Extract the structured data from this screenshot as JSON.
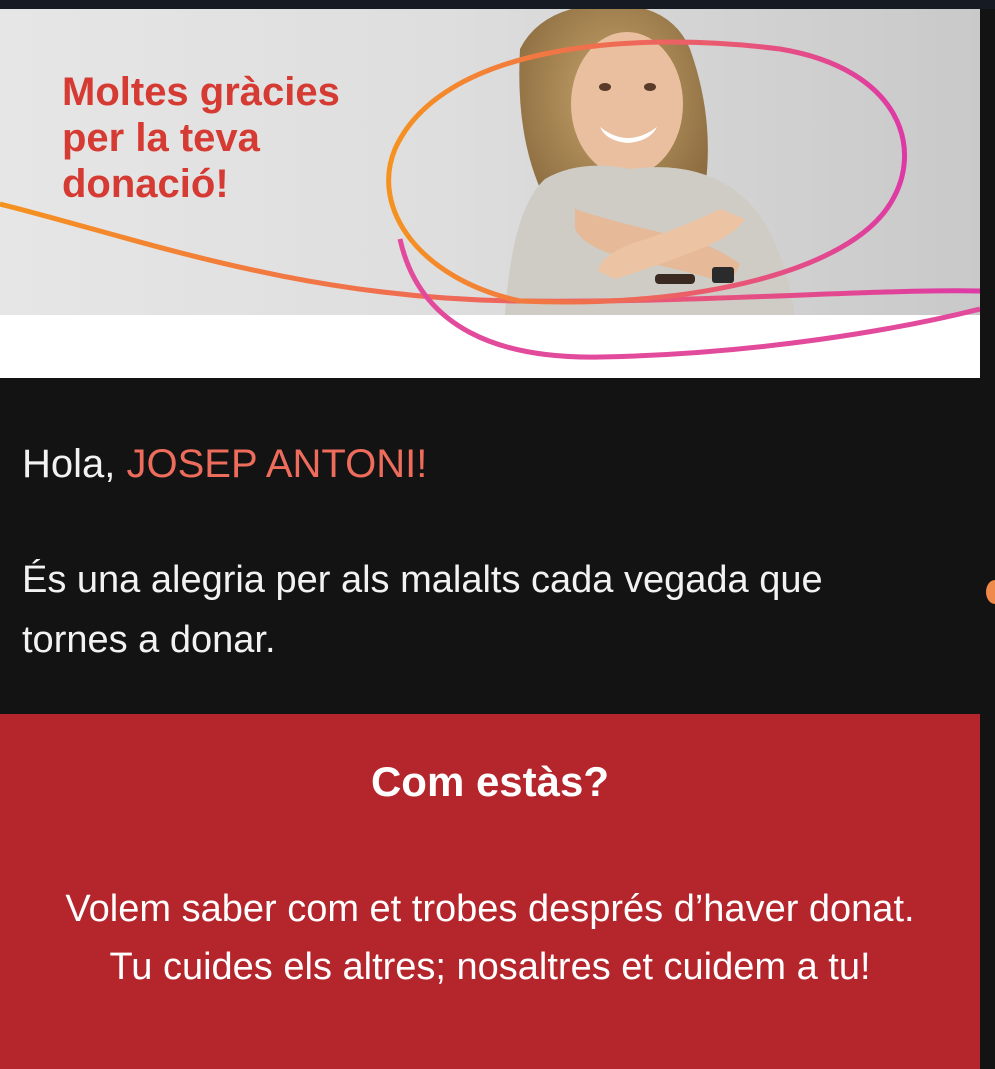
{
  "banner": {
    "title_lines": [
      "Moltes gràcies",
      "per la teva",
      "donació!"
    ],
    "colors": {
      "title": "#d53a33",
      "stroke_orange": "#f5921f",
      "stroke_pink": "#de3aa6"
    }
  },
  "greeting": {
    "prefix": "Hola,",
    "name": "JOSEP ANTONI!",
    "name_color": "#ee6c5c"
  },
  "intro": {
    "text": "És una alegria per als malalts cada vegada que tornes a donar."
  },
  "wellbeing": {
    "heading": "Com estàs?",
    "lines": [
      "Volem saber com et trobes després d’haver donat.",
      "Tu cuides els altres; nosaltres et cuidem a tu!"
    ],
    "background_color": "#b4252c"
  }
}
